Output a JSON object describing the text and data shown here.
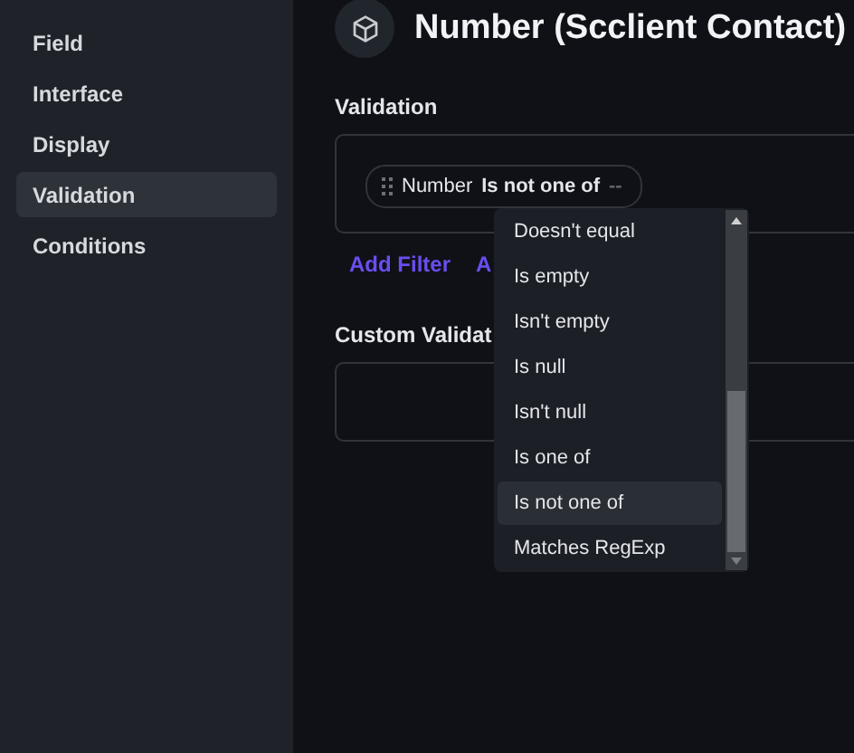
{
  "sidebar": {
    "items": [
      {
        "label": "Field",
        "selected": false
      },
      {
        "label": "Interface",
        "selected": false
      },
      {
        "label": "Display",
        "selected": false
      },
      {
        "label": "Validation",
        "selected": true
      },
      {
        "label": "Conditions",
        "selected": false
      }
    ]
  },
  "header": {
    "title": "Number (Scclient Contact)"
  },
  "validation": {
    "label": "Validation",
    "filter": {
      "field": "Number",
      "operator": "Is not one of",
      "value": "--"
    },
    "links": [
      "Add Filter",
      "A"
    ]
  },
  "custom_validation": {
    "label": "Custom Validat"
  },
  "dropdown": {
    "options": [
      {
        "label": "Doesn't equal",
        "selected": false
      },
      {
        "label": "Is empty",
        "selected": false
      },
      {
        "label": "Isn't empty",
        "selected": false
      },
      {
        "label": "Is null",
        "selected": false
      },
      {
        "label": "Isn't null",
        "selected": false
      },
      {
        "label": "Is one of",
        "selected": false
      },
      {
        "label": "Is not one of",
        "selected": true
      },
      {
        "label": "Matches RegExp",
        "selected": false
      }
    ]
  }
}
